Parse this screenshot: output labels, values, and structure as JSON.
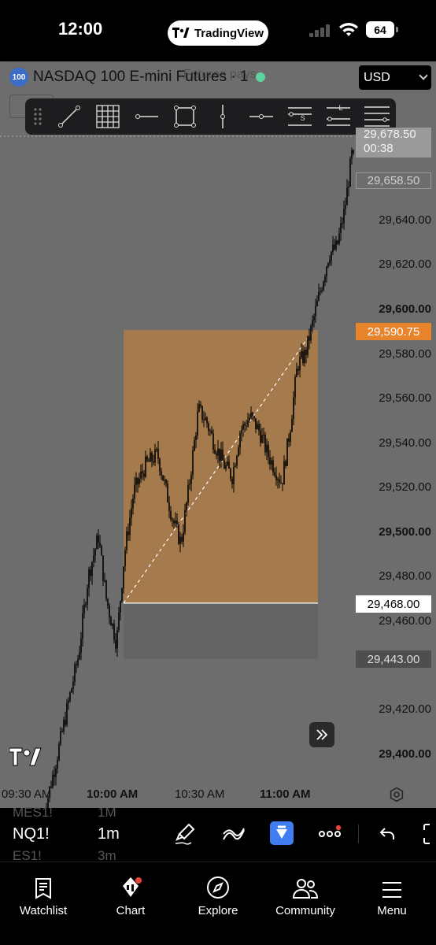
{
  "status_bar": {
    "time": "12:00",
    "app_pill": "TradingView",
    "battery": "64"
  },
  "chart_header": {
    "badge": "100",
    "title": "NASDAQ 100 E-mini Futures · 1",
    "overlay_text": "Futures pays",
    "currency": "USD"
  },
  "colors": {
    "accent_orange": "#e8842b",
    "position_fill": "#a57a4c",
    "chart_bg": "#6d6d6d",
    "candle": "#000000"
  },
  "drawing_toolbar": {
    "icons": [
      "drag-handle-icon",
      "trend-line-icon",
      "grid-icon",
      "horizontal-ray-icon",
      "rectangle-icon",
      "vertical-line-icon",
      "horizontal-line-icon",
      "short-position-icon",
      "long-position-icon",
      "fib-lines-icon"
    ],
    "short_label": "S",
    "long_label": "L"
  },
  "price_axis": {
    "labels": [
      {
        "text": "29,640.00",
        "bold": false
      },
      {
        "text": "29,620.00",
        "bold": false
      },
      {
        "text": "29,600.00",
        "bold": true
      },
      {
        "text": "29,580.00",
        "bold": false
      },
      {
        "text": "29,560.00",
        "bold": false
      },
      {
        "text": "29,540.00",
        "bold": false
      },
      {
        "text": "29,520.00",
        "bold": false
      },
      {
        "text": "29,500.00",
        "bold": true
      },
      {
        "text": "29,480.00",
        "bold": false
      },
      {
        "text": "29,460.00",
        "bold": false
      },
      {
        "text": "29,420.00",
        "bold": false
      },
      {
        "text": "29,400.00",
        "bold": true
      }
    ],
    "current_price": "29,678.50",
    "countdown": "00:38",
    "last_price": "29,658.50",
    "target_price": "29,590.75",
    "entry_price": "29,468.00",
    "stop_price": "29,443.00"
  },
  "time_axis": {
    "labels": [
      "09:30 AM",
      "10:00 AM",
      "10:30 AM",
      "11:00 AM"
    ]
  },
  "bottom_toolbar": {
    "symbol": "NQ1!",
    "interval": "1m",
    "ghost_symbol_above": "MES1!",
    "ghost_interval_above": "1M",
    "ghost_symbol_below": "ES1!",
    "ghost_interval_below": "3m"
  },
  "tab_bar": {
    "tabs": [
      {
        "label": "Watchlist"
      },
      {
        "label": "Chart"
      },
      {
        "label": "Explore"
      },
      {
        "label": "Community"
      },
      {
        "label": "Menu"
      }
    ]
  }
}
